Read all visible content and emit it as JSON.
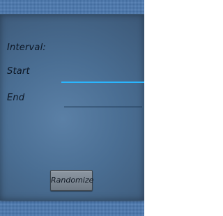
{
  "panel": {
    "title": "Interval:",
    "start_label": "Start",
    "end_label": "End"
  },
  "button": {
    "randomize_label": "Randomize"
  },
  "colors": {
    "start_underline": "#2ab6ff",
    "end_underline": "#142d48",
    "outer_background": "#4a78b0"
  }
}
